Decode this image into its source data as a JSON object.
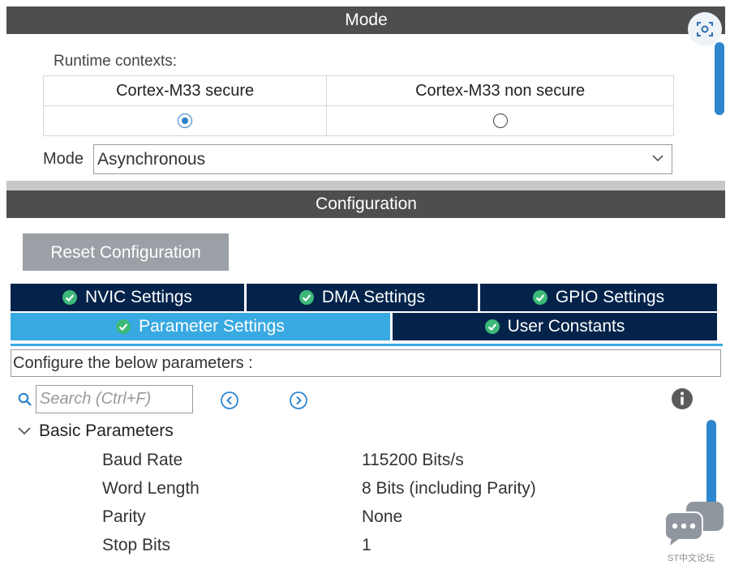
{
  "mode_section": {
    "title": "Mode",
    "runtime_label": "Runtime contexts:",
    "contexts": [
      {
        "label": "Cortex-M33 secure",
        "selected": true
      },
      {
        "label": "Cortex-M33 non secure",
        "selected": false
      }
    ],
    "mode_label": "Mode",
    "mode_value": "Asynchronous"
  },
  "config_section": {
    "title": "Configuration",
    "reset_button": "Reset Configuration",
    "tabs_row1": [
      "NVIC Settings",
      "DMA Settings",
      "GPIO Settings"
    ],
    "tabs_row2": [
      "Parameter Settings",
      "User Constants"
    ],
    "active_tab": "Parameter Settings",
    "description": "Configure the below parameters :",
    "search_placeholder": "Search (Ctrl+F)",
    "group_title": "Basic Parameters",
    "parameters": [
      {
        "name": "Baud Rate",
        "value": "115200 Bits/s"
      },
      {
        "name": "Word Length",
        "value": "8 Bits (including Parity)"
      },
      {
        "name": "Parity",
        "value": "None"
      },
      {
        "name": "Stop Bits",
        "value": "1"
      }
    ]
  },
  "watermark": "ST中文论坛",
  "colors": {
    "header_bg": "#4e4e4e",
    "tab_bg": "#03234b",
    "tab_active": "#38a9e1",
    "check_green": "#3cb878",
    "scroll_blue": "#2e86cf",
    "radio_blue": "#2f7fc7"
  },
  "icons": [
    "scan-icon",
    "chevron-down-icon",
    "check-circle-icon",
    "search-icon",
    "prev-circle-icon",
    "next-circle-icon",
    "info-icon",
    "collapse-chevron-icon",
    "chat-icon"
  ]
}
